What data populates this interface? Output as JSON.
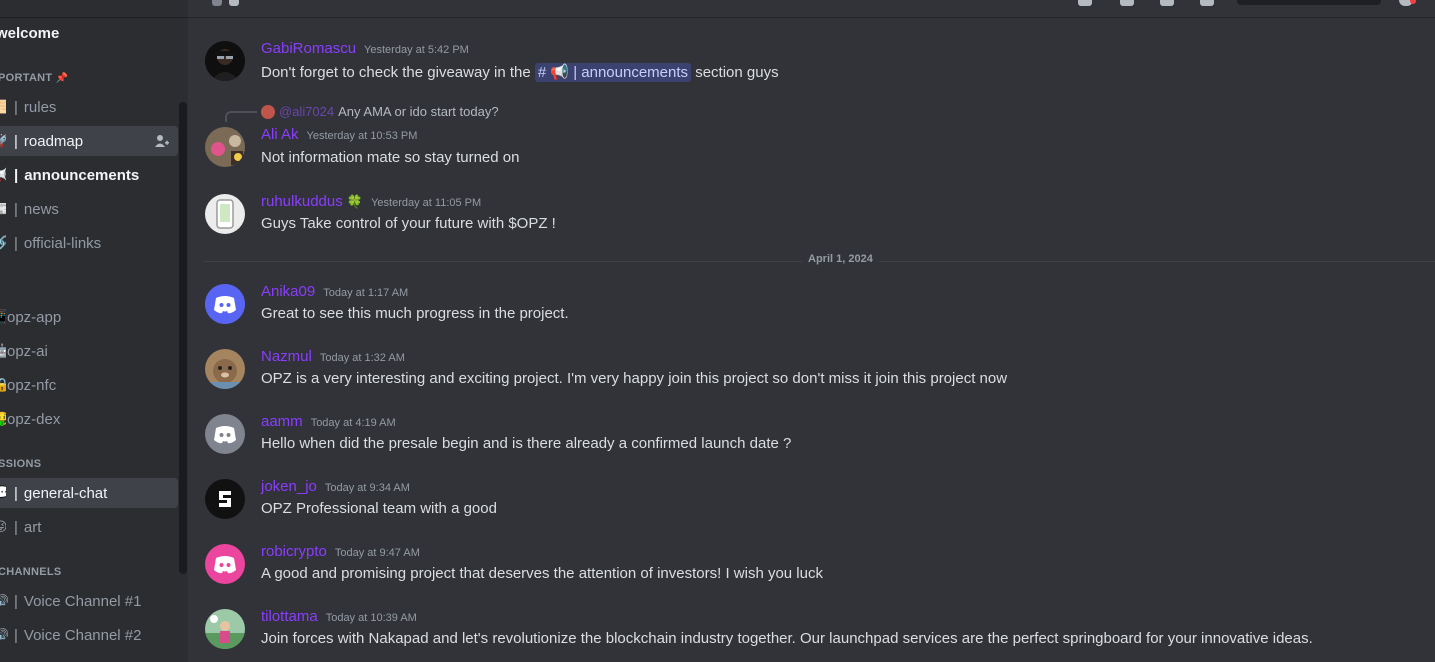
{
  "server": {
    "welcome_label": "welcome",
    "categories": {
      "important": "PORTANT",
      "pin_icon": "pushpin-icon",
      "discussions": "SSIONS",
      "voice": "CHANNELS"
    },
    "channels_important": [
      {
        "emoji": "📜",
        "label": "rules",
        "state": "normal"
      },
      {
        "emoji": "🚀",
        "label": "roadmap",
        "state": "active"
      },
      {
        "emoji": "📢",
        "label": "announcements",
        "state": "unread"
      },
      {
        "emoji": "📰",
        "label": "news",
        "state": "normal"
      },
      {
        "emoji": "🔗",
        "label": "official-links",
        "state": "normal"
      }
    ],
    "channels_products": [
      {
        "emoji": "📱",
        "label": "opz-app"
      },
      {
        "emoji": "🤖",
        "label": "opz-ai"
      },
      {
        "emoji": "🔒",
        "label": "opz-nfc"
      },
      {
        "emoji": "🤑",
        "label": "opz-dex"
      }
    ],
    "channels_discussions": [
      {
        "emoji": "💬",
        "label": "general-chat",
        "state": "active"
      },
      {
        "emoji": "😜",
        "label": "art",
        "state": "normal"
      }
    ],
    "voice_channels": [
      {
        "label": "Voice Channel #1"
      },
      {
        "label": "Voice Channel #2"
      }
    ]
  },
  "chat": {
    "date_divider": "April 1, 2024",
    "messages": [
      {
        "user": "GabiRomascu",
        "time": "Yesterday at 5:42 PM",
        "text_before": "Don't forget to check the giveaway in the",
        "mention": "# 📢 | announcements",
        "text_after": "section guys",
        "avatar_color": "#1c1c1c"
      },
      {
        "reply_to_user": "@ali7024",
        "reply_text": "Any AMA or ido start today?",
        "user": "Ali Ak",
        "time": "Yesterday at 10:53 PM",
        "text": "Not information mate so stay turned on",
        "avatar_color": "#6b5a48"
      },
      {
        "user": "ruhulkuddus",
        "user_badge": "🍀",
        "time": "Yesterday at 11:05 PM",
        "text": "Guys Take control of your future with $OPZ !",
        "avatar_color": "#e8e8e8"
      },
      {
        "user": "Anika09",
        "time": "Today at 1:17 AM",
        "text": "Great to see this much progress in the project.",
        "avatar_color": "#5865f2"
      },
      {
        "user": "Nazmul",
        "time": "Today at 1:32 AM",
        "text": "OPZ is a very interesting and exciting project. I'm very happy join this project so don't miss it join this project now",
        "avatar_color": "#9a7a5a"
      },
      {
        "user": "aamm",
        "time": "Today at 4:19 AM",
        "text": "Hello when did the presale begin and is there already a confirmed launch date ?",
        "avatar_color": "#80848e"
      },
      {
        "user": "joken_jo",
        "time": "Today at 9:34 AM",
        "text": "OPZ Professional team with a good",
        "avatar_color": "#111111"
      },
      {
        "user": "robicrypto",
        "time": "Today at 9:47 AM",
        "text": "A good and promising project that deserves the attention of investors! I wish you luck",
        "avatar_color": "#eb459e"
      },
      {
        "user": "tilottama",
        "time": "Today at 10:39 AM",
        "text": "Join forces with Nakapad and let's revolutionize the blockchain industry together. Our launchpad services are the perfect springboard for your innovative ideas.",
        "avatar_color": "#7ab87a"
      }
    ]
  },
  "colors": {
    "username": "#8a3dff",
    "background": "#313338",
    "sidebar": "#2b2d31",
    "mention_bg": "#3c4270"
  }
}
